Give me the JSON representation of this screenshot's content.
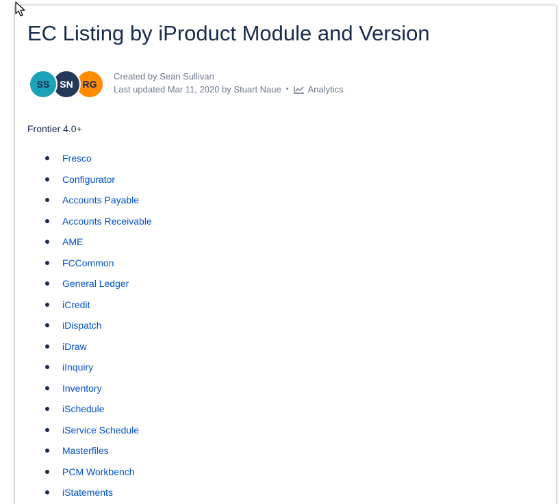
{
  "page": {
    "title": "EC Listing by iProduct Module and Version",
    "link_color": "#0052cc",
    "text_color": "#172b4d",
    "meta_color": "#6b778c"
  },
  "byline": {
    "avatars": [
      {
        "initials": "SS",
        "bg": "#1ca2b8",
        "fg": "#172b4d"
      },
      {
        "initials": "SN",
        "bg": "#253858",
        "fg": "#ffffff"
      },
      {
        "initials": "RG",
        "bg": "#ff8b00",
        "fg": "#172b4d"
      }
    ],
    "created": "Created by Sean Sullivan",
    "updated": "Last updated Mar 11, 2020 by Stuart Naue",
    "separator": "•",
    "analytics_icon": "line-chart-icon",
    "analytics_label": "Analytics"
  },
  "section": {
    "label": "Frontier 4.0+"
  },
  "modules": [
    "Fresco",
    "Configurator",
    "Accounts Payable",
    "Accounts Receivable",
    "AME",
    "FCCommon",
    "General Ledger",
    "iCredit",
    "iDispatch",
    "iDraw",
    "iInquiry",
    "Inventory",
    "iSchedule",
    "iService Schedule",
    "Masterfiles",
    "PCM Workbench",
    "iStatements"
  ]
}
